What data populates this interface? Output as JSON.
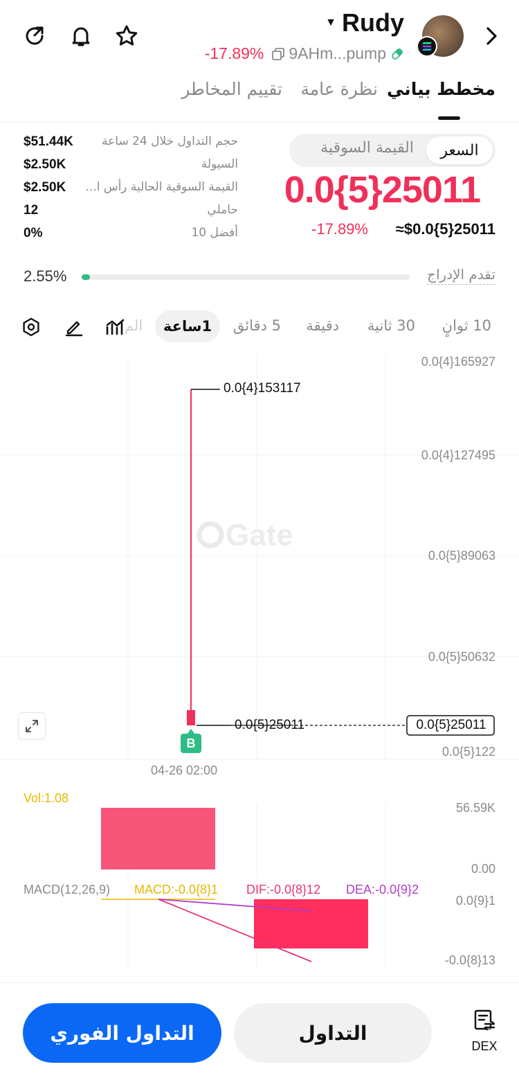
{
  "header": {
    "coin_name": "Rudy",
    "change": "-17.89%",
    "contract": "9AHm...pump",
    "icons": [
      "share-icon",
      "bell-icon",
      "star-icon",
      "chevron-right-icon"
    ]
  },
  "tabs": [
    {
      "label": "مخطط بياني",
      "active": true
    },
    {
      "label": "نظرة عامة",
      "active": false
    },
    {
      "label": "تقييم المخاطر",
      "active": false
    }
  ],
  "stats": [
    {
      "label": "حجم التداول خلال 24 ساعة",
      "value": "$51.44K"
    },
    {
      "label": "السيولة",
      "value": "$2.50K"
    },
    {
      "label": "القيمة السوقية الحالية رأس ا...",
      "value": "$2.50K"
    },
    {
      "label": "حاملي",
      "value": "12"
    },
    {
      "label": "أفضل 10",
      "value": "0%"
    }
  ],
  "price_toggle": {
    "active": "السعر",
    "other": "القيمة السوقية"
  },
  "price": {
    "big": "0.0{5}25011",
    "usd": "≈$0.0{5}25011",
    "change": "-17.89%"
  },
  "listing": {
    "label": "تقدم الإدراج",
    "percent_text": "2.55%",
    "fraction": 0.0255
  },
  "timeframes": {
    "items": [
      "10 ثوانٍ",
      "30 ثانية",
      "دقيقة",
      "5 دقائق"
    ],
    "active": "1ساعة",
    "faded": "الم"
  },
  "chart": {
    "y_labels": [
      "0.0{4}165927",
      "0.0{4}127495",
      "0.0{5}89063",
      "0.0{5}50632",
      "0.0{5}122"
    ],
    "high_label": "0.0{4}153117",
    "low_label": "0.0{5}25011",
    "current_label": "0.0{5}25011",
    "time_label": "04-26 02:00",
    "buy_marker": "B",
    "watermark": "Gate",
    "colors": {
      "down": "#f0305a",
      "buy": "#2ebd85"
    }
  },
  "volume": {
    "label": "Vol:1.08",
    "max": "56.59K",
    "min": "0.00"
  },
  "macd": {
    "label": "MACD(12,26,9)",
    "macd": "MACD:-0.0{8}1",
    "dif": "DIF:-0.0{8}12",
    "dea": "DEA:-0.0{9}2",
    "max": "0.0{9}1",
    "min": "-0.0{8}13",
    "colors": {
      "macd": "#e8b800",
      "dif": "#e8327a",
      "dea": "#b03bc8"
    }
  },
  "actions": {
    "spot": "التداول الفوري",
    "trade": "التداول",
    "dex": "DEX"
  }
}
